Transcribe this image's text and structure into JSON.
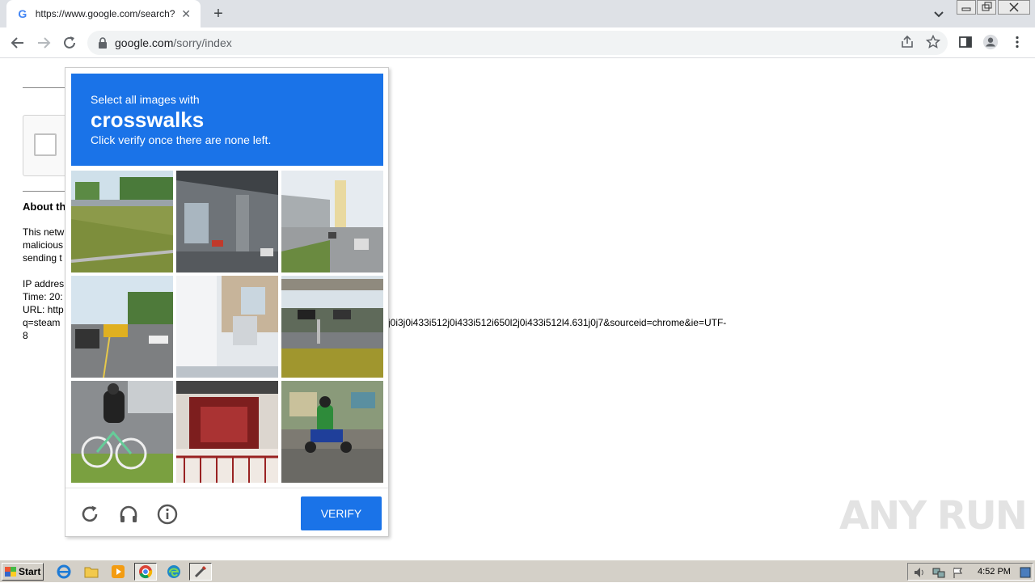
{
  "browser": {
    "tab_title": "https://www.google.com/search?q=",
    "tab_favicon": "G",
    "tab_close": "✕",
    "new_tab": "+",
    "url_host": "google.com",
    "url_path": "/sorry/index"
  },
  "page": {
    "about_heading": "About th",
    "para_lines": [
      "This netw",
      "malicious",
      "sending t"
    ],
    "info_lines": [
      "IP addres",
      "Time: 20:",
      "URL: http",
      "q=steam"
    ],
    "url_tail": "j0i3j0i433i512j0i433i512i650l2j0i433i512l4.631j0j7&sourceid=chrome&ie=UTF-",
    "url_tail_2": "8"
  },
  "captcha": {
    "instruction": "Select all images with",
    "target": "crosswalks",
    "hint": "Click verify once there are none left.",
    "verify_label": "VERIFY",
    "reload_icon": "reload-icon",
    "audio_icon": "headphones-icon",
    "info_icon": "info-icon"
  },
  "watermark": "ANY RUN",
  "taskbar": {
    "start_label": "Start",
    "clock": "4:52 PM"
  },
  "colors": {
    "captcha_blue": "#1a73e8",
    "tab_strip": "#dee1e6",
    "omnibox": "#f1f3f4",
    "taskbar": "#d4d0c8"
  }
}
